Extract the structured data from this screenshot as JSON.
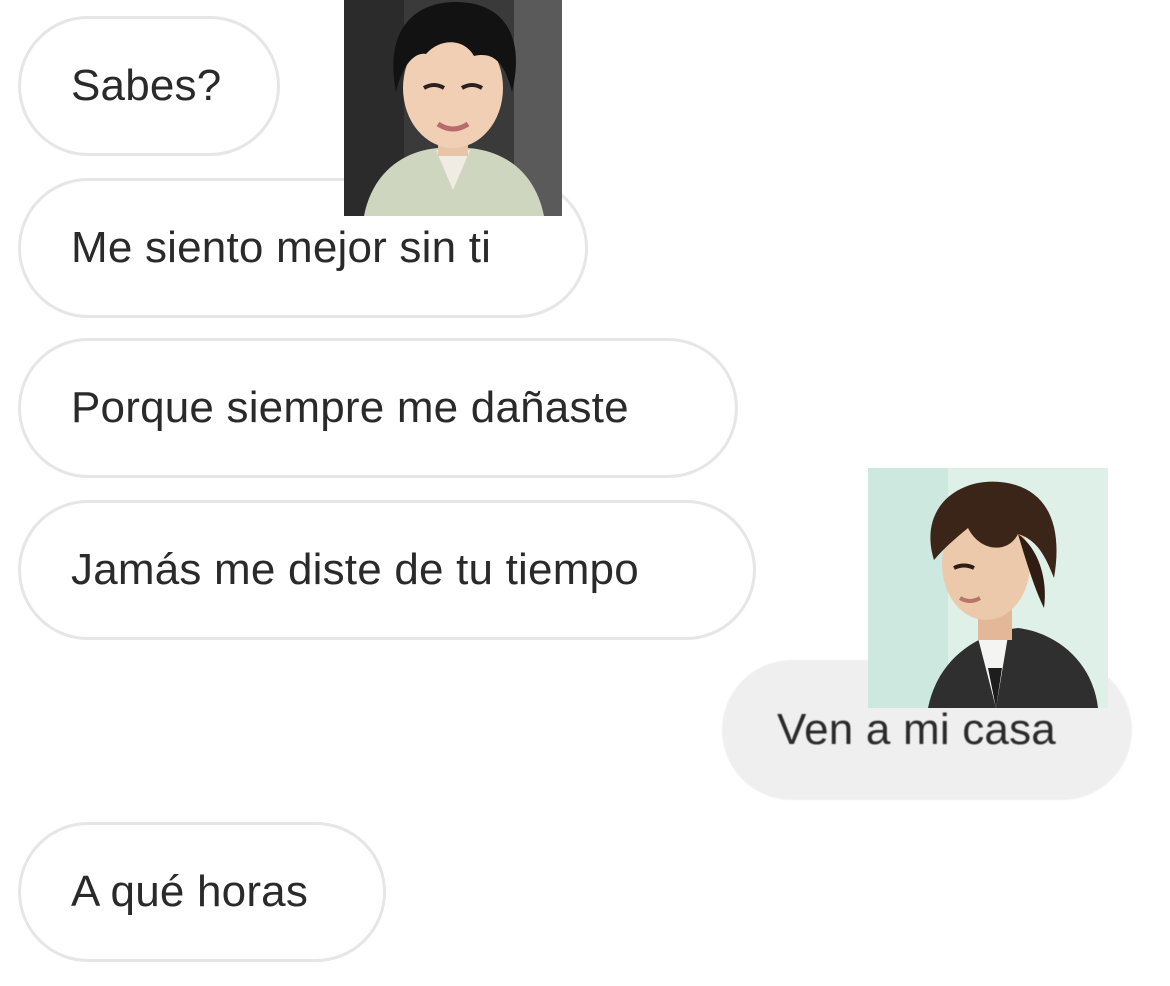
{
  "conversation": {
    "messages": [
      {
        "side": "incoming",
        "text": "Sabes?"
      },
      {
        "side": "incoming",
        "text": "Me siento mejor sin ti"
      },
      {
        "side": "incoming",
        "text": "Porque siempre me dañaste"
      },
      {
        "side": "incoming",
        "text": "Jamás me diste de tu tiempo"
      },
      {
        "side": "outgoing",
        "text": "Ven a mi casa"
      },
      {
        "side": "incoming",
        "text": "A qué horas"
      }
    ]
  },
  "overlays": {
    "photo_1": {
      "icon": "person-photo-icon",
      "background": "#3b3b3b"
    },
    "photo_2": {
      "icon": "person-photo-icon",
      "background": "#d8ece4"
    }
  },
  "colors": {
    "incoming_bubble_bg": "#ffffff",
    "incoming_bubble_border": "#e6e6e6",
    "outgoing_bubble_bg": "#efefef",
    "text": "#2a2a2a"
  }
}
